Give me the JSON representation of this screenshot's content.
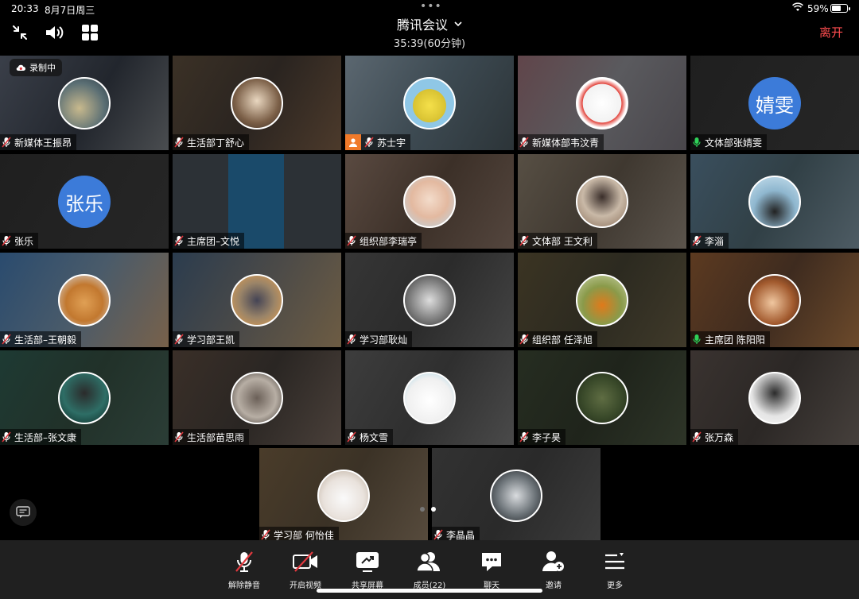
{
  "status_bar": {
    "time": "20:33",
    "date": "8月7日周三",
    "battery": "59%",
    "battery_level": 0.59
  },
  "header": {
    "title": "腾讯会议",
    "duration": "35:39(60分钟)",
    "leave_label": "离开"
  },
  "recording": {
    "label": "录制中"
  },
  "participants": [
    {
      "name": "新媒体王振昂",
      "mic": "muted"
    },
    {
      "name": "生活部丁舒心",
      "mic": "muted"
    },
    {
      "name": "苏士宇",
      "mic": "muted"
    },
    {
      "name": "新媒体部韦汶青",
      "mic": "muted"
    },
    {
      "name": "文体部张婧雯",
      "mic": "on",
      "avatar_text": "婧雯"
    },
    {
      "name": "张乐",
      "mic": "muted",
      "avatar_text": "张乐"
    },
    {
      "name": "主席团–文悦",
      "mic": "muted"
    },
    {
      "name": "组织部李瑞亭",
      "mic": "muted"
    },
    {
      "name": "文体部 王文利",
      "mic": "muted"
    },
    {
      "name": "李淄",
      "mic": "muted"
    },
    {
      "name": "生活部–王朝毅",
      "mic": "muted"
    },
    {
      "name": "学习部王凯",
      "mic": "muted"
    },
    {
      "name": "学习部耿灿",
      "mic": "muted"
    },
    {
      "name": "组织部 任泽旭",
      "mic": "muted"
    },
    {
      "name": "主席团 陈阳阳",
      "mic": "on"
    },
    {
      "name": "生活部–张文康",
      "mic": "muted"
    },
    {
      "name": "生活部苗思雨",
      "mic": "muted"
    },
    {
      "name": "杨文雪",
      "mic": "muted"
    },
    {
      "name": "李子昊",
      "mic": "muted"
    },
    {
      "name": "张万森",
      "mic": "muted"
    },
    {
      "name": "学习部 何怡佳",
      "mic": "muted"
    },
    {
      "name": "李晶晶",
      "mic": "muted"
    }
  ],
  "toolbar": {
    "unmute": "解除静音",
    "video": "开启视频",
    "share": "共享屏幕",
    "members": "成员(22)",
    "chat": "聊天",
    "invite": "邀请",
    "more": "更多"
  },
  "colors": {
    "leave": "#ff4d4f",
    "avatar_blue": "#3c7bd9",
    "mic_on": "#2ed158",
    "mic_muted": "#e0383e"
  }
}
